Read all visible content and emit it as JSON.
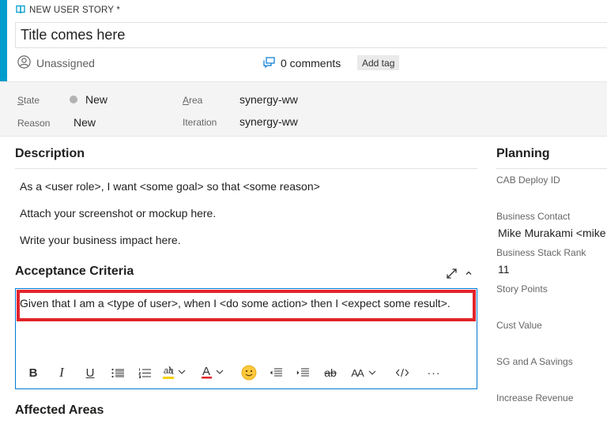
{
  "header": {
    "work_item_type": "NEW USER STORY *",
    "title_value": "Title comes here",
    "assignee": "Unassigned",
    "comments": "0 comments",
    "add_tag": "Add tag"
  },
  "fields": {
    "state_label": "State",
    "state_value": "New",
    "reason_label": "Reason",
    "reason_value": "New",
    "area_label": "Area",
    "area_value": "synergy-ww",
    "iteration_label": "Iteration",
    "iteration_value": "synergy-ww"
  },
  "description": {
    "title": "Description",
    "lines": [
      "As a <user role>, I want <some goal> so that <some reason>",
      "Attach your screenshot or mockup here.",
      "Write your business impact here."
    ]
  },
  "acceptance_criteria": {
    "title": "Acceptance Criteria",
    "text": "Given that I am a <type of user>, when I <do some action> then I <expect some result>."
  },
  "toolbar": {
    "bold": "B",
    "italic": "I",
    "underline": "U",
    "font_color": "A",
    "font_size": "AA",
    "strikethrough": "ab",
    "more": "···"
  },
  "affected_areas": {
    "title": "Affected Areas"
  },
  "planning": {
    "title": "Planning",
    "cab_deploy_id_label": "CAB Deploy ID",
    "business_contact_label": "Business Contact",
    "business_contact_value": "Mike Murakami <mike",
    "business_stack_rank_label": "Business Stack Rank",
    "business_stack_rank_value": "11",
    "story_points_label": "Story Points",
    "cust_value_label": "Cust Value",
    "sg_and_a_savings_label": "SG and A Savings",
    "increase_revenue_label": "Increase Revenue"
  },
  "colors": {
    "accent": "#009ccc",
    "highlight": "#e3232a",
    "focus_border": "#0078d4",
    "state_dot": "#b2b2b2"
  }
}
